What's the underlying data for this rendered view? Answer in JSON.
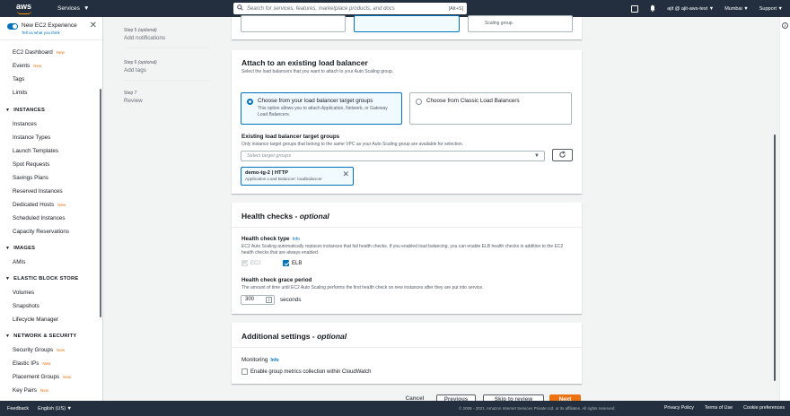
{
  "topnav": {
    "logo": "aws",
    "services": "Services",
    "search_placeholder": "Search for services, features, marketplace products, and docs",
    "search_shortcut": "[Alt+S]",
    "account": "ajit @ ajit-aws-test",
    "region": "Mumbai",
    "support": "Support"
  },
  "sidebar": {
    "new_experience_title": "New EC2 Experience",
    "new_experience_sub": "Tell us what you think",
    "top_items": [
      {
        "label": "EC2 Dashboard",
        "badge": "New"
      },
      {
        "label": "Events",
        "badge": "New"
      },
      {
        "label": "Tags",
        "badge": ""
      },
      {
        "label": "Limits",
        "badge": ""
      }
    ],
    "sections": [
      {
        "title": "INSTANCES",
        "items": [
          {
            "label": "Instances",
            "badge": ""
          },
          {
            "label": "Instance Types",
            "badge": ""
          },
          {
            "label": "Launch Templates",
            "badge": ""
          },
          {
            "label": "Spot Requests",
            "badge": ""
          },
          {
            "label": "Savings Plans",
            "badge": ""
          },
          {
            "label": "Reserved Instances",
            "badge": ""
          },
          {
            "label": "Dedicated Hosts",
            "badge": "New"
          },
          {
            "label": "Scheduled Instances",
            "badge": ""
          },
          {
            "label": "Capacity Reservations",
            "badge": ""
          }
        ]
      },
      {
        "title": "IMAGES",
        "items": [
          {
            "label": "AMIs",
            "badge": ""
          }
        ]
      },
      {
        "title": "ELASTIC BLOCK STORE",
        "items": [
          {
            "label": "Volumes",
            "badge": ""
          },
          {
            "label": "Snapshots",
            "badge": ""
          },
          {
            "label": "Lifecycle Manager",
            "badge": ""
          }
        ]
      },
      {
        "title": "NETWORK & SECURITY",
        "items": [
          {
            "label": "Security Groups",
            "badge": "New"
          },
          {
            "label": "Elastic IPs",
            "badge": "New"
          },
          {
            "label": "Placement Groups",
            "badge": "New"
          },
          {
            "label": "Key Pairs",
            "badge": "New"
          },
          {
            "label": "Network Interfaces",
            "badge": ""
          }
        ]
      }
    ]
  },
  "steps": [
    {
      "label": "Step 5",
      "opt": "(optional)",
      "name": "Add notifications"
    },
    {
      "label": "Step 6",
      "opt": "(optional)",
      "name": "Add tags"
    },
    {
      "label": "Step 7",
      "opt": "",
      "name": "Review"
    }
  ],
  "top_panel": {
    "tile3_text": "Scaling group."
  },
  "load_balancer": {
    "title": "Attach to an existing load balancer",
    "description": "Select the load balancers that you want to attach to your Auto Scaling group.",
    "option1_title": "Choose from your load balancer target groups",
    "option1_desc": "This option allows you to attach Application, Network, or Gateway Load Balancers.",
    "option2_title": "Choose from Classic Load Balancers",
    "target_groups_label": "Existing load balancer target groups",
    "target_groups_desc": "Only instance target groups that belong to the same VPC as your Auto Scaling group are available for selection.",
    "select_placeholder": "Select target groups",
    "token_title": "demo-tg-2 | HTTP",
    "token_desc": "Application Load Balancer: loadbalancer"
  },
  "health": {
    "title": "Health checks - ",
    "title_opt": "optional",
    "type_label": "Health check type",
    "info": "Info",
    "type_desc": "EC2 Auto Scaling automatically replaces instances that fail health checks. If you enabled load balancing, you can enable ELB health checks in addition to the EC2 health checks that are always enabled.",
    "ec2": "EC2",
    "elb": "ELB",
    "grace_label": "Health check grace period",
    "grace_desc": "The amount of time until EC2 Auto Scaling performs the first health check on new instances after they are put into service.",
    "grace_value": "300",
    "grace_unit": "seconds"
  },
  "additional": {
    "title": "Additional settings - ",
    "title_opt": "optional",
    "monitoring_label": "Monitoring",
    "info": "Info",
    "cloudwatch": "Enable group metrics collection within CloudWatch"
  },
  "actions": {
    "cancel": "Cancel",
    "previous": "Previous",
    "skip": "Skip to review",
    "next": "Next"
  },
  "footer": {
    "feedback": "Feedback",
    "language": "English (US)",
    "copyright": "© 2008 - 2021, Amazon Internet Services Private Ltd. or its affiliates. All rights reserved.",
    "privacy": "Privacy Policy",
    "terms": "Terms of Use",
    "cookies": "Cookie preferences"
  },
  "colors": {
    "nav_bg": "#232f3e",
    "accent": "#0073bb",
    "primary_button": "#ec7211"
  }
}
